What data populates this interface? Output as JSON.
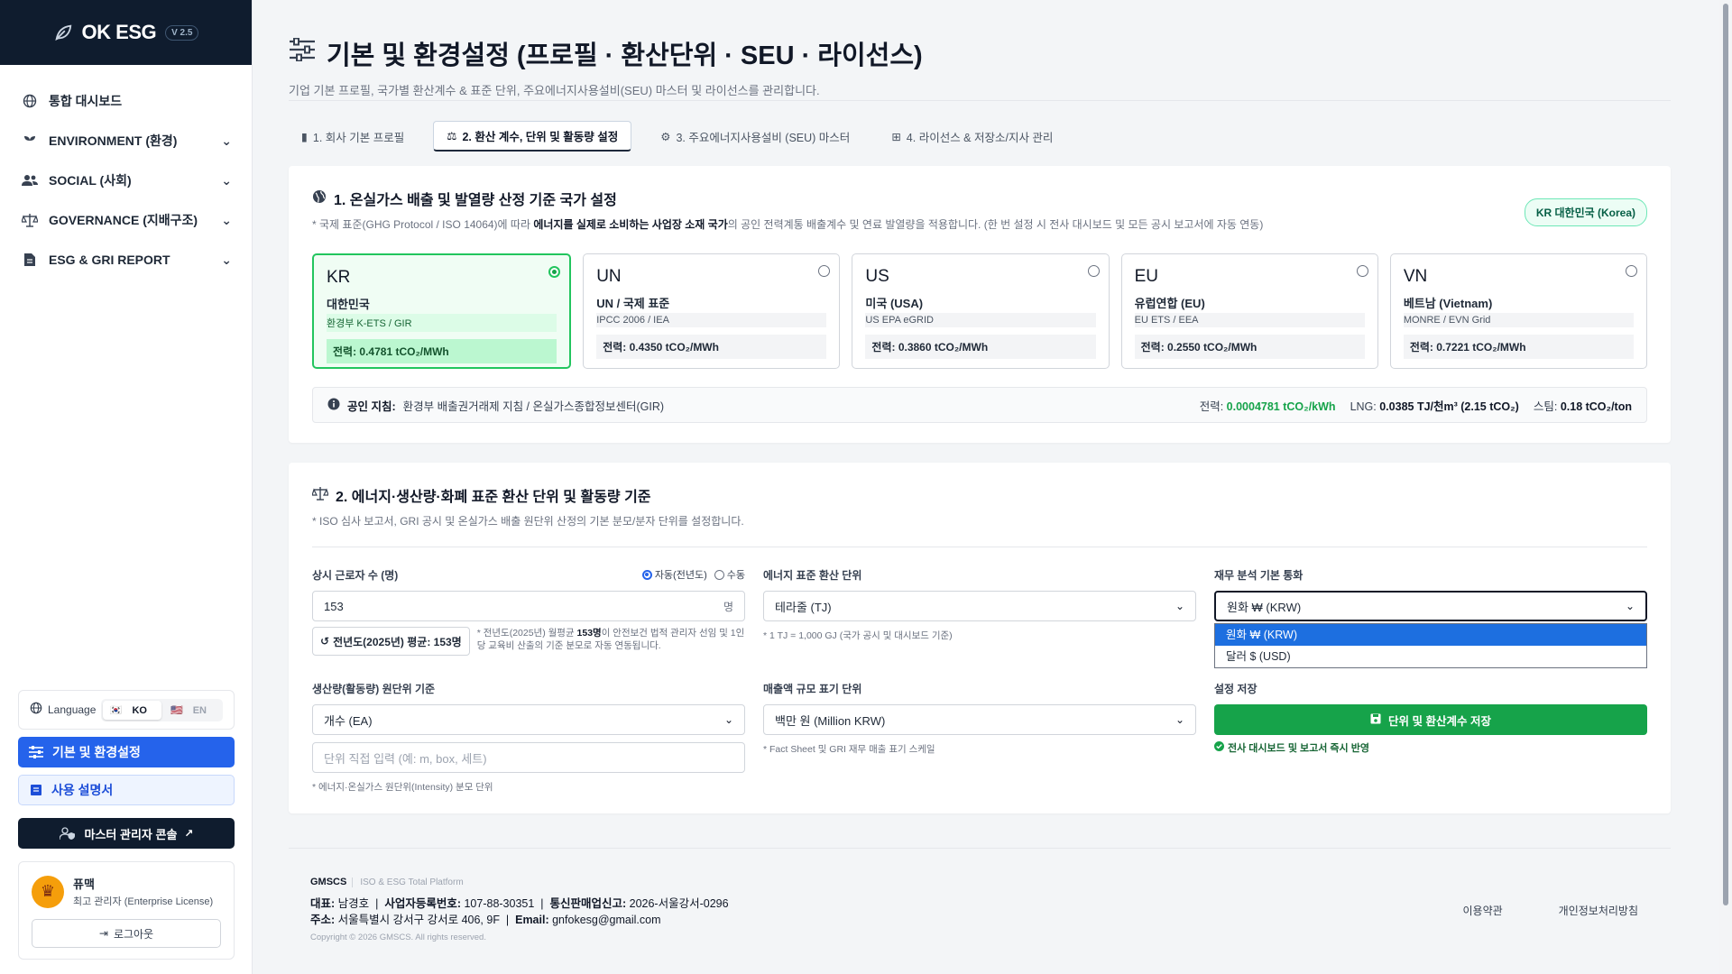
{
  "brand": {
    "name": "OK ESG",
    "version": "V 2.5"
  },
  "sidebar": {
    "items": [
      {
        "label": "통합 대시보드",
        "icon": "globe-icon"
      },
      {
        "label": "ENVIRONMENT (환경)",
        "icon": "sprout-icon"
      },
      {
        "label": "SOCIAL (사회)",
        "icon": "users-icon"
      },
      {
        "label": "GOVERNANCE (지배구조)",
        "icon": "scale-icon"
      },
      {
        "label": "ESG & GRI REPORT",
        "icon": "report-icon"
      }
    ],
    "language": {
      "label": "Language",
      "ko": "KO",
      "en": "EN"
    },
    "settings_button": "기본 및 환경설정",
    "manual_button": "사용 설명서",
    "master_button": "마스터 관리자 콘솔",
    "user": {
      "name": "퓨맥",
      "role": "최고 관리자 (Enterprise License)"
    },
    "logout": "로그아웃"
  },
  "page": {
    "title": "기본 및 환경설정 (프로필 · 환산단위 · SEU · 라이선스)",
    "subtitle": "기업 기본 프로필, 국가별 환산계수 & 표준 단위, 주요에너지사용설비(SEU) 마스터 및 라이선스를 관리합니다."
  },
  "tabs": [
    {
      "label": "1. 회사 기본 프로필"
    },
    {
      "label": "2. 환산 계수, 단위 및 활동량 설정"
    },
    {
      "label": "3. 주요에너지사용설비 (SEU) 마스터"
    },
    {
      "label": "4. 라이선스 & 저장소/지사 관리"
    }
  ],
  "section1": {
    "title": "1. 온실가스 배출 및 발열량 산정 기준 국가 설정",
    "note_pre": "* 국제 표준(GHG Protocol / ISO 14064)에 따라 ",
    "note_bold": "에너지를 실제로 소비하는 사업장 소재 국가",
    "note_post": "의 공인 전력계통 배출계수 및 연료 발열량을 적용합니다. (한 번 설정 시 전사 대시보드 및 모든 공시 보고서에 자동 연동)",
    "badge": "KR 대한민국 (Korea)",
    "countries": [
      {
        "code": "KR",
        "name": "대한민국",
        "source": "환경부 K-ETS / GIR",
        "factor": "전력: 0.4781 tCO₂/MWh",
        "selected": true
      },
      {
        "code": "UN",
        "name": "UN / 국제 표준",
        "source": "IPCC 2006 / IEA",
        "factor": "전력: 0.4350 tCO₂/MWh",
        "selected": false
      },
      {
        "code": "US",
        "name": "미국 (USA)",
        "source": "US EPA eGRID",
        "factor": "전력: 0.3860 tCO₂/MWh",
        "selected": false
      },
      {
        "code": "EU",
        "name": "유럽연합 (EU)",
        "source": "EU ETS / EEA",
        "factor": "전력: 0.2550 tCO₂/MWh",
        "selected": false
      },
      {
        "code": "VN",
        "name": "베트남 (Vietnam)",
        "source": "MONRE / EVN Grid",
        "factor": "전력: 0.7221 tCO₂/MWh",
        "selected": false
      }
    ],
    "guide": {
      "label": "공인 지침:",
      "text": "환경부 배출권거래제 지침 / 온실가스종합정보센터(GIR)",
      "power_label": "전력:",
      "power_value": "0.0004781 tCO₂/kWh",
      "lng_label": "LNG:",
      "lng_value": "0.0385 TJ/천m³ (2.15 tCO₂)",
      "steam_label": "스팀:",
      "steam_value": "0.18 tCO₂/ton"
    }
  },
  "section2": {
    "title": "2. 에너지·생산량·화폐 표준 환산 단위 및 활동량 기준",
    "note": "* ISO 심사 보고서, GRI 공시 및 온실가스 배출 원단위 산정의 기본 분모/분자 단위를 설정합니다.",
    "workers": {
      "label": "상시 근로자 수 (명)",
      "auto": "자동(전년도)",
      "manual": "수동",
      "value": "153",
      "suffix": "명",
      "avg_button": "전년도(2025년) 평균: 153명",
      "hint_pre": "* 전년도(2025년) 월평균 ",
      "hint_bold": "153명",
      "hint_post": "이 안전보건 법적 관리자 선임 및 1인당 교육비 산출의 기준 분모로 자동 연동됩니다."
    },
    "energy_unit": {
      "label": "에너지 표준 환산 단위",
      "value": "테라줄 (TJ)",
      "note": "* 1 TJ = 1,000 GJ (국가 공시 및 대시보드 기준)"
    },
    "currency": {
      "label": "재무 분석 기본 통화",
      "value": "원화 ₩ (KRW)",
      "options": [
        "원화 ₩ (KRW)",
        "달러 $ (USD)"
      ]
    },
    "production": {
      "label": "생산량(활동량) 원단위 기준",
      "value": "개수 (EA)",
      "placeholder": "단위 직접 입력 (예: m, box, 세트)",
      "note": "* 에너지·온실가스 원단위(Intensity) 분모 단위"
    },
    "revenue": {
      "label": "매출액 규모 표기 단위",
      "value": "백만 원 (Million KRW)",
      "note": "* Fact Sheet 및 GRI 재무 매출 표기 스케일"
    },
    "save": {
      "label": "설정 저장",
      "button": "단위 및 환산계수 저장",
      "reflect": "전사 대시보드 및 보고서 즉시 반영"
    }
  },
  "footer": {
    "company": "GMSCS",
    "platform": "ISO & ESG Total Platform",
    "ceo_label": "대표:",
    "ceo": "남경호",
    "biz_label": "사업자등록번호:",
    "biz": "107-88-30351",
    "mail_order_label": "통신판매업신고:",
    "mail_order": "2026-서울강서-0296",
    "addr_label": "주소:",
    "addr": "서울특별시 강서구 강서로 406, 9F",
    "email_label": "Email:",
    "email": "gnfokesg@gmail.com",
    "copyright": "Copyright © 2026 GMSCS. All rights reserved.",
    "terms": "이용약관",
    "privacy": "개인정보처리방침"
  },
  "colors": {
    "accent": "#2563eb",
    "success": "#16a34a",
    "navy": "#0f1c2e"
  }
}
